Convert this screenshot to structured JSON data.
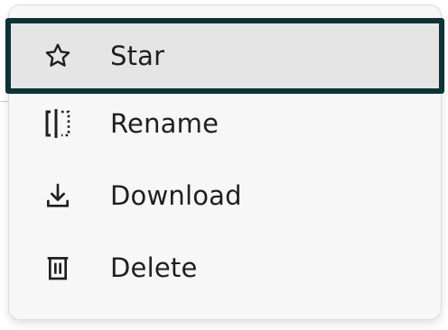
{
  "menu": {
    "items": [
      {
        "label": "Star",
        "icon": "star-outline-icon"
      },
      {
        "label": "Rename",
        "icon": "rename-icon"
      },
      {
        "label": "Download",
        "icon": "download-icon"
      },
      {
        "label": "Delete",
        "icon": "trash-icon"
      }
    ],
    "highlight_border_color": "#0f3236",
    "highlight_background": "#e5e5e5"
  }
}
